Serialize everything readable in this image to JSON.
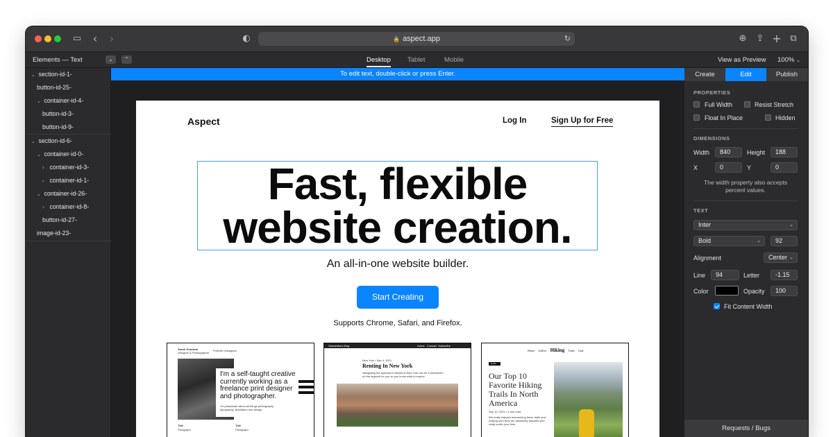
{
  "browser": {
    "url": "aspect.app"
  },
  "editor": {
    "left_title": "Elements — Text",
    "device_tabs": [
      "Desktop",
      "Tablet",
      "Mobile"
    ],
    "view_as_preview": "View as Preview",
    "zoom": "100%",
    "edit_hint": "To edit text, double-click or press Enter."
  },
  "tree": [
    {
      "label": "section-id-1-",
      "chev": "⌄"
    },
    {
      "label": "button-id-25-",
      "chev": ""
    },
    {
      "label": "container-id-4-",
      "chev": "⌄"
    },
    {
      "label": "button-id-3-",
      "chev": ""
    },
    {
      "label": "button-id-9-",
      "chev": ""
    },
    {
      "label": "section-id-6-",
      "chev": "⌄"
    },
    {
      "label": "container-id-0-",
      "chev": "⌄"
    },
    {
      "label": "container-id-3-",
      "chev": "›"
    },
    {
      "label": "container-id-1-",
      "chev": "›"
    },
    {
      "label": "container-id-26-",
      "chev": "⌄"
    },
    {
      "label": "container-id-8-",
      "chev": "›"
    },
    {
      "label": "button-id-27-",
      "chev": ""
    },
    {
      "label": "image-id-23-",
      "chev": ""
    }
  ],
  "site": {
    "brand": "Aspect",
    "nav_login": "Log In",
    "nav_signup": "Sign Up for Free",
    "hero_line1": "Fast, flexible",
    "hero_line2": "website creation.",
    "subhead": "An all-in-one website builder.",
    "cta": "Start Creating",
    "supports": "Supports Chrome, Safari, and Firefox."
  },
  "thumbs": {
    "t1_name": "Sarah Goodwin",
    "t1_role": "Designer & Photographer",
    "t1_nav1": "Portfolio",
    "t1_nav2": "Instagram",
    "t1_quote": "I'm a self-taught creative currently working as a freelance print designer and photographer.",
    "t1_body": "I'm passionate about all things photography, typography, illustration and design.",
    "t1_col1_h": "Title",
    "t1_col1_p": "Paragraph",
    "t1_col2_h": "Title",
    "t1_col2_p": "Paragraph",
    "t2_brand": "Samantha's Blog",
    "t2_nav1": "Home",
    "t2_nav2": "Contact",
    "t2_nav3": "Subscribe",
    "t2_date": "New York • Sep 4, 2021",
    "t2_title": "Renting In New York",
    "t2_intro1": "Navigating the apartment market in New York can be a minefield! I",
    "t2_intro2": "do the legwork for you so you know what to expect.",
    "t3_home": "Home",
    "t3_gallery": "Gallery",
    "t3_brand": "Hiking",
    "t3_trails": "Trails",
    "t3_gear": "Gear",
    "t3_badge": "Guide",
    "t3_title": "Our Top 10 Favorite Hiking Trails In North America",
    "t3_date": "Sep 10, 2021 • 4 min read",
    "t3_body": "We really enjoyed researching these trails and making sure they are absolutely beautiful and really worth your time."
  },
  "panel": {
    "tabs": [
      "Create",
      "Edit",
      "Publish"
    ],
    "properties_h": "PROPERTIES",
    "full_width": "Full Width",
    "resist_stretch": "Resist Stretch",
    "float_in_place": "Float In Place",
    "hidden": "Hidden",
    "dimensions_h": "DIMENSIONS",
    "width_label": "Width",
    "width_value": "840",
    "height_label": "Height",
    "height_value": "188",
    "x_label": "X",
    "x_value": "0",
    "y_label": "Y",
    "y_value": "0",
    "dim_note": "The width property also accepts percent values.",
    "text_h": "TEXT",
    "font": "Inter",
    "weight": "Bold",
    "size": "92",
    "alignment_label": "Alignment",
    "alignment_value": "Center",
    "line_label": "Line",
    "line_value": "94",
    "letter_label": "Letter",
    "letter_value": "-1.15",
    "color_label": "Color",
    "opacity_label": "Opacity",
    "opacity_value": "100",
    "fit_content": "Fit Content Width",
    "requests": "Requests / Bugs"
  },
  "colors": {
    "accent": "#0a84ff",
    "panel_bg": "#2b2b2d",
    "canvas_bg": "#1f1f21",
    "text_color_swatch": "#000000"
  }
}
